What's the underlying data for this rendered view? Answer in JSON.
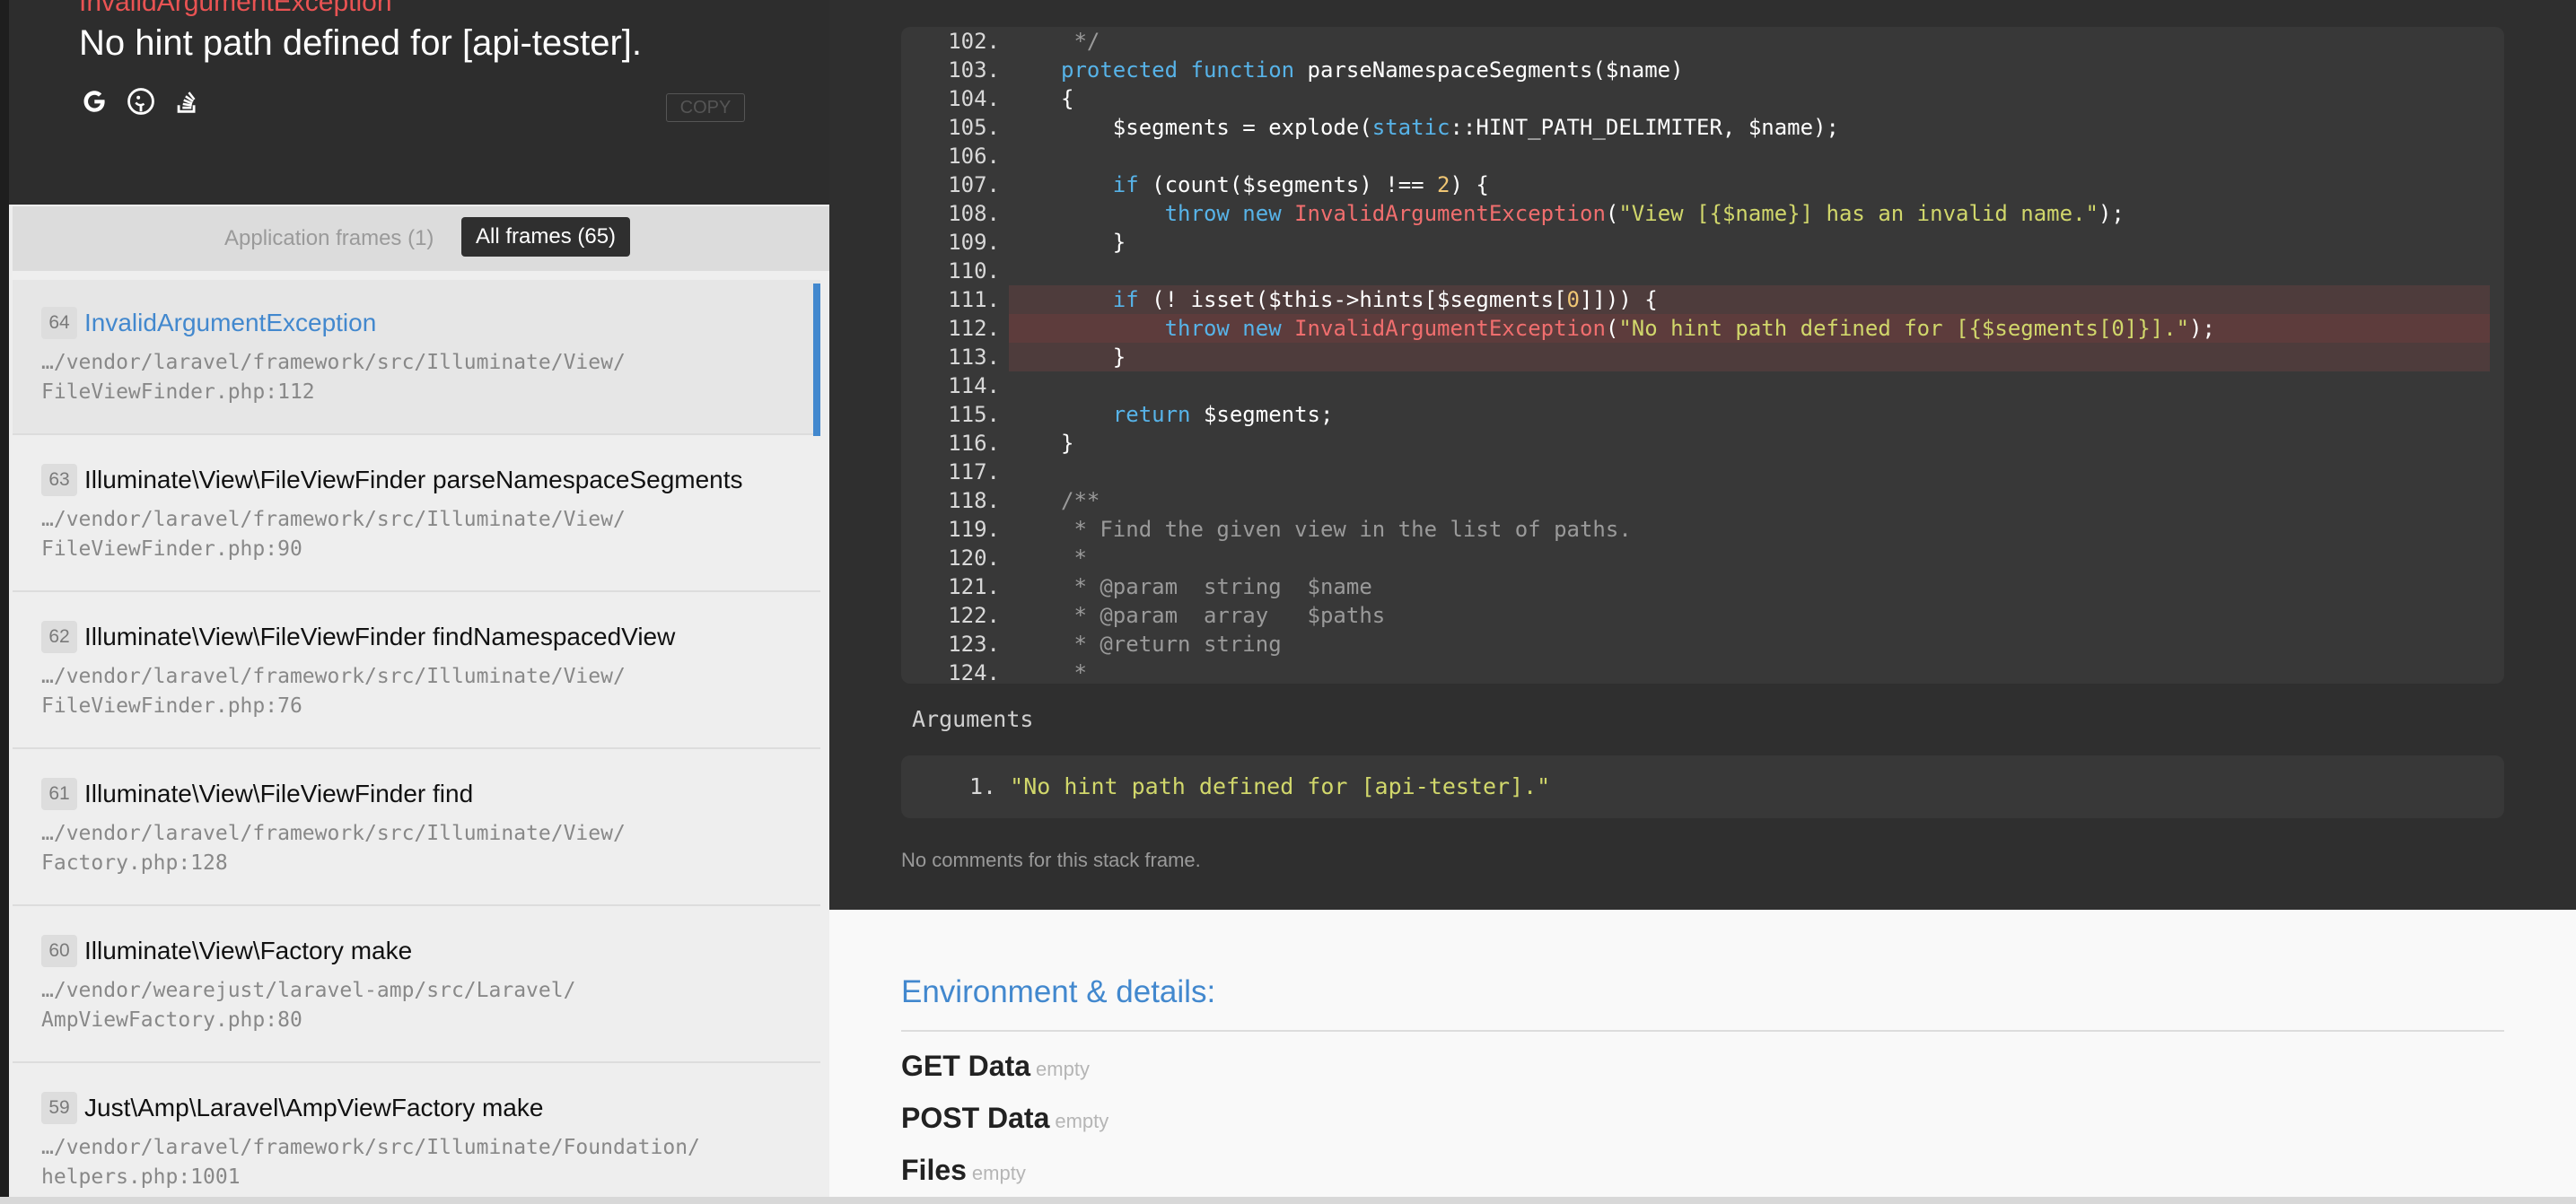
{
  "header": {
    "exception_class": "InvalidArgumentException",
    "exception_message": "No hint path defined for [api-tester].",
    "copy_label": "COPY",
    "icons": [
      "google-icon",
      "duckduckgo-icon",
      "stackoverflow-icon"
    ]
  },
  "frame_filter": {
    "application_frames": "Application frames (1)",
    "all_frames": "All frames (65)"
  },
  "frames": [
    {
      "index": "64",
      "title": "InvalidArgumentException",
      "path_line1": "…/vendor/laravel/framework/src/Illuminate/View/",
      "path_line2": "FileViewFinder.php:112"
    },
    {
      "index": "63",
      "title": "Illuminate\\View\\FileViewFinder parseNamespaceSegments",
      "path_line1": "…/vendor/laravel/framework/src/Illuminate/View/",
      "path_line2": "FileViewFinder.php:90"
    },
    {
      "index": "62",
      "title": "Illuminate\\View\\FileViewFinder findNamespacedView",
      "path_line1": "…/vendor/laravel/framework/src/Illuminate/View/",
      "path_line2": "FileViewFinder.php:76"
    },
    {
      "index": "61",
      "title": "Illuminate\\View\\FileViewFinder find",
      "path_line1": "…/vendor/laravel/framework/src/Illuminate/View/",
      "path_line2": "Factory.php:128"
    },
    {
      "index": "60",
      "title": "Illuminate\\View\\Factory make",
      "path_line1": "…/vendor/wearejust/laravel-amp/src/Laravel/",
      "path_line2": "AmpViewFactory.php:80"
    },
    {
      "index": "59",
      "title": "Just\\Amp\\Laravel\\AmpViewFactory make",
      "path_line1": "…/vendor/laravel/framework/src/Illuminate/Foundation/",
      "path_line2": "helpers.php:1001"
    }
  ],
  "code": {
    "lines": [
      {
        "n": "102.",
        "text": "     */"
      },
      {
        "n": "103.",
        "text": "    protected function parseNamespaceSegments($name)"
      },
      {
        "n": "104.",
        "text": "    {"
      },
      {
        "n": "105.",
        "text": "        $segments = explode(static::HINT_PATH_DELIMITER, $name);"
      },
      {
        "n": "106.",
        "text": ""
      },
      {
        "n": "107.",
        "text": "        if (count($segments) !== 2) {"
      },
      {
        "n": "108.",
        "text": "            throw new InvalidArgumentException(\"View [{$name}] has an invalid name.\");"
      },
      {
        "n": "109.",
        "text": "        }"
      },
      {
        "n": "110.",
        "text": ""
      },
      {
        "n": "111.",
        "text": "        if (! isset($this->hints[$segments[0]])) {"
      },
      {
        "n": "112.",
        "text": "            throw new InvalidArgumentException(\"No hint path defined for [{$segments[0]}].\");"
      },
      {
        "n": "113.",
        "text": "        }"
      },
      {
        "n": "114.",
        "text": ""
      },
      {
        "n": "115.",
        "text": "        return $segments;"
      },
      {
        "n": "116.",
        "text": "    }"
      },
      {
        "n": "117.",
        "text": ""
      },
      {
        "n": "118.",
        "text": "    /**"
      },
      {
        "n": "119.",
        "text": "     * Find the given view in the list of paths."
      },
      {
        "n": "120.",
        "text": "     *"
      },
      {
        "n": "121.",
        "text": "     * @param  string  $name"
      },
      {
        "n": "122.",
        "text": "     * @param  array   $paths"
      },
      {
        "n": "123.",
        "text": "     * @return string"
      },
      {
        "n": "124.",
        "text": "     *"
      }
    ]
  },
  "arguments": {
    "label": "Arguments",
    "items": [
      {
        "n": "1.",
        "value": "\"No hint path defined for [api-tester].\""
      }
    ]
  },
  "comments": "No comments for this stack frame.",
  "environment": {
    "title": "Environment & details:",
    "rows": [
      {
        "key": "GET Data",
        "value": "empty"
      },
      {
        "key": "POST Data",
        "value": "empty"
      },
      {
        "key": "Files",
        "value": "empty"
      }
    ]
  },
  "colors": {
    "accent": "#4288ce",
    "exception": "#e95353",
    "dark_bg": "#2f2f2f",
    "code_bg": "#383838"
  }
}
